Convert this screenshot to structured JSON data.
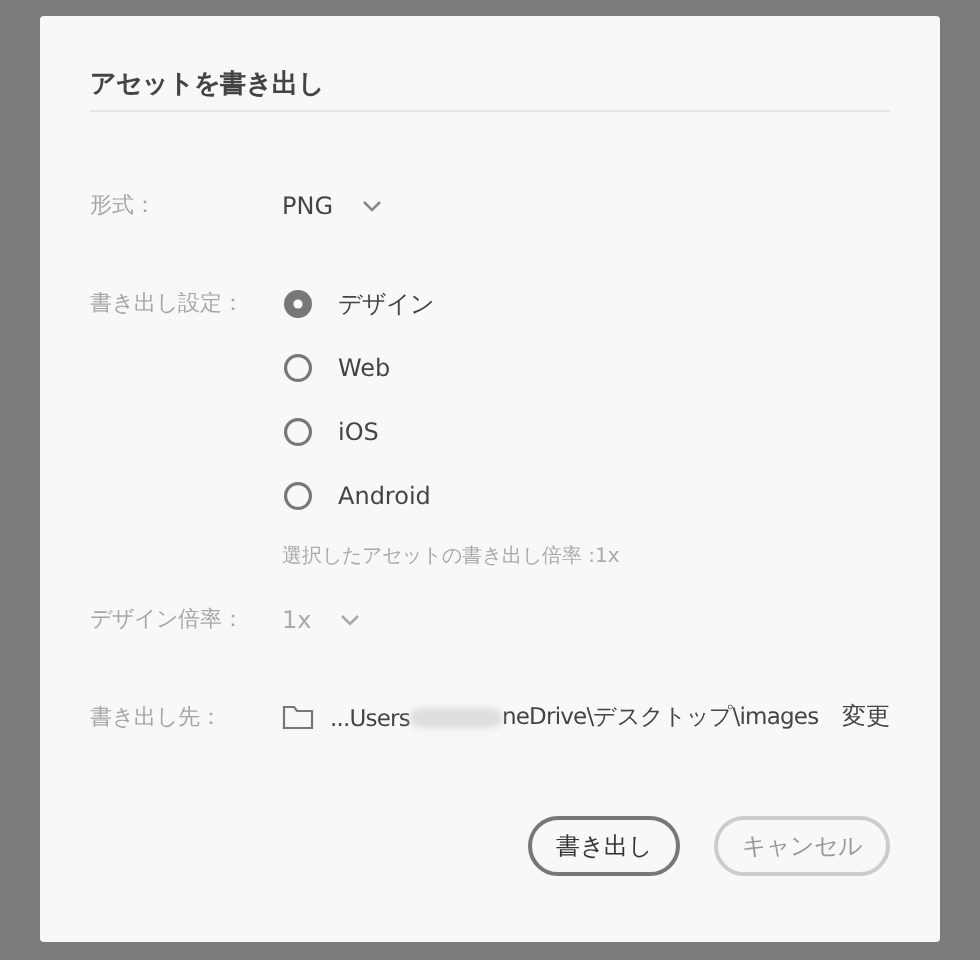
{
  "dialog": {
    "title": "アセットを書き出し"
  },
  "format": {
    "label": "形式：",
    "value": "PNG"
  },
  "export_settings": {
    "label": "書き出し設定：",
    "options": [
      {
        "label": "デザイン",
        "selected": true
      },
      {
        "label": "Web",
        "selected": false
      },
      {
        "label": "iOS",
        "selected": false
      },
      {
        "label": "Android",
        "selected": false
      }
    ],
    "note": "選択したアセットの書き出し倍率 :1x"
  },
  "design_scale": {
    "label": "デザイン倍率：",
    "value": "1x",
    "disabled": true
  },
  "destination": {
    "label": "書き出し先：",
    "path_start": "...Users",
    "path_end": "neDrive\\デスクトップ\\images",
    "change": "変更"
  },
  "buttons": [
    {
      "label": "書き出し",
      "kind": "primary"
    },
    {
      "label": "キャンセル",
      "kind": "secondary"
    }
  ]
}
